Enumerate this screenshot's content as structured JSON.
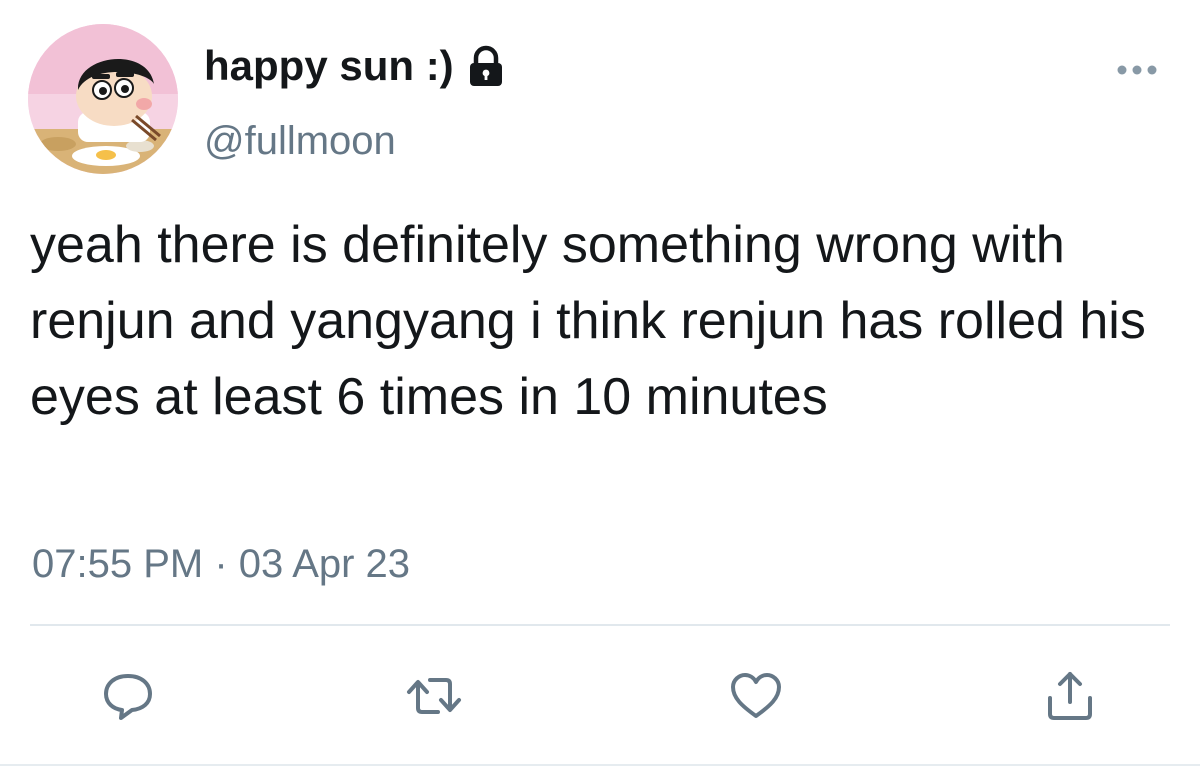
{
  "tweet": {
    "display_name": "happy sun :)",
    "handle": "@fullmoon",
    "text": "yeah there is definitely something wrong with renjun and yangyang i think renjun has rolled his eyes at least 6 times in 10 minutes",
    "time": "07:55 PM",
    "separator": "·",
    "date": "03 Apr 23",
    "protected": true
  },
  "icons": {
    "lock": "lock-icon",
    "more": "more-icon",
    "reply": "reply-icon",
    "retweet": "retweet-icon",
    "like": "like-icon",
    "share": "share-icon"
  },
  "colors": {
    "text": "#14171a",
    "secondary": "#657786",
    "icon": "#657786",
    "divider": "#e1e8ed"
  }
}
